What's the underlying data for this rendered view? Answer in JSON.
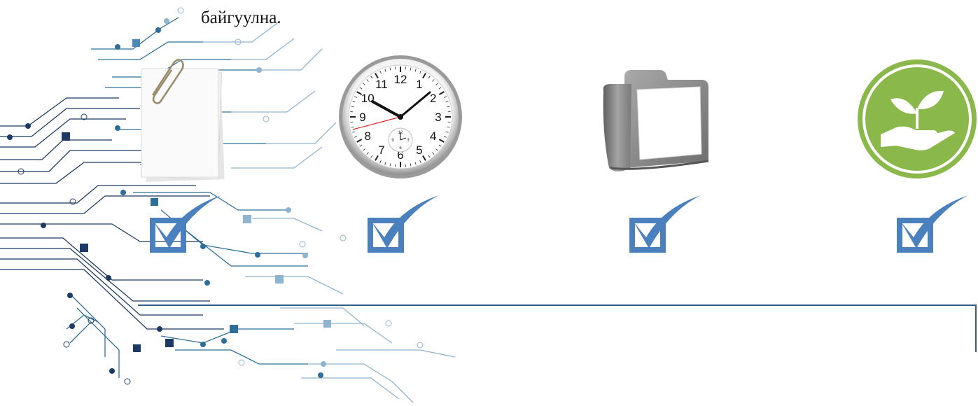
{
  "heading": {
    "text": "байгуулна."
  },
  "colors": {
    "circuit_dark": "#1c3a63",
    "circuit_mid": "#2e6f99",
    "circuit_light": "#8fb4cf",
    "check_blue": "#4a80bd",
    "rule": "#2f5f86",
    "plant_green": "#8ab84a",
    "clock_hand_red": "#e02020"
  },
  "icons": [
    {
      "name": "paper-clip-notes-icon"
    },
    {
      "name": "wall-clock-icon"
    },
    {
      "name": "folder-icon"
    },
    {
      "name": "plant-in-hand-icon"
    }
  ],
  "clock": {
    "numbers": [
      "12",
      "1",
      "2",
      "3",
      "4",
      "5",
      "6",
      "7",
      "8",
      "9",
      "10",
      "11"
    ],
    "sub_dial_numbers": [
      "12",
      "3",
      "6",
      "9"
    ]
  }
}
